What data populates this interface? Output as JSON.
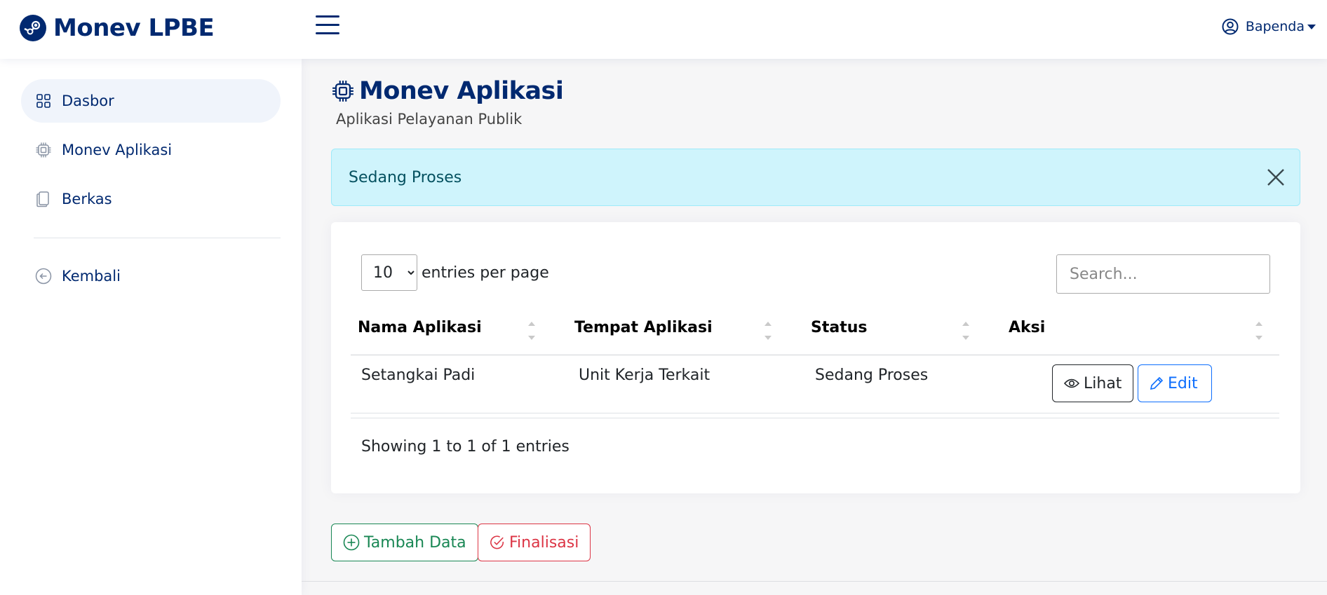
{
  "header": {
    "app_name": "Monev LPBE",
    "user_name": "Bapenda"
  },
  "sidebar": {
    "items": [
      {
        "label": "Dasbor",
        "icon": "grid-icon",
        "active": true
      },
      {
        "label": "Monev Aplikasi",
        "icon": "cpu-icon",
        "active": false
      },
      {
        "label": "Berkas",
        "icon": "files-icon",
        "active": false
      }
    ],
    "back_label": "Kembali"
  },
  "page": {
    "title": "Monev Aplikasi",
    "subtitle": "Aplikasi Pelayanan Publik"
  },
  "alert": {
    "message": "Sedang Proses"
  },
  "table": {
    "per_page_value": "10",
    "per_page_label": "entries per page",
    "search_placeholder": "Search...",
    "columns": [
      "Nama Aplikasi",
      "Tempat Aplikasi",
      "Status",
      "Aksi"
    ],
    "rows": [
      {
        "nama": "Setangkai Padi",
        "tempat": "Unit Kerja Terkait",
        "status": "Sedang Proses",
        "view_label": "Lihat",
        "edit_label": "Edit"
      }
    ],
    "info": "Showing 1 to 1 of 1 entries"
  },
  "actions": {
    "add_label": "Tambah Data",
    "finalize_label": "Finalisasi"
  },
  "colors": {
    "brand": "#012970",
    "alert_bg": "#cff4fc",
    "success": "#198754",
    "danger": "#dc3545",
    "primary": "#0d6efd"
  }
}
